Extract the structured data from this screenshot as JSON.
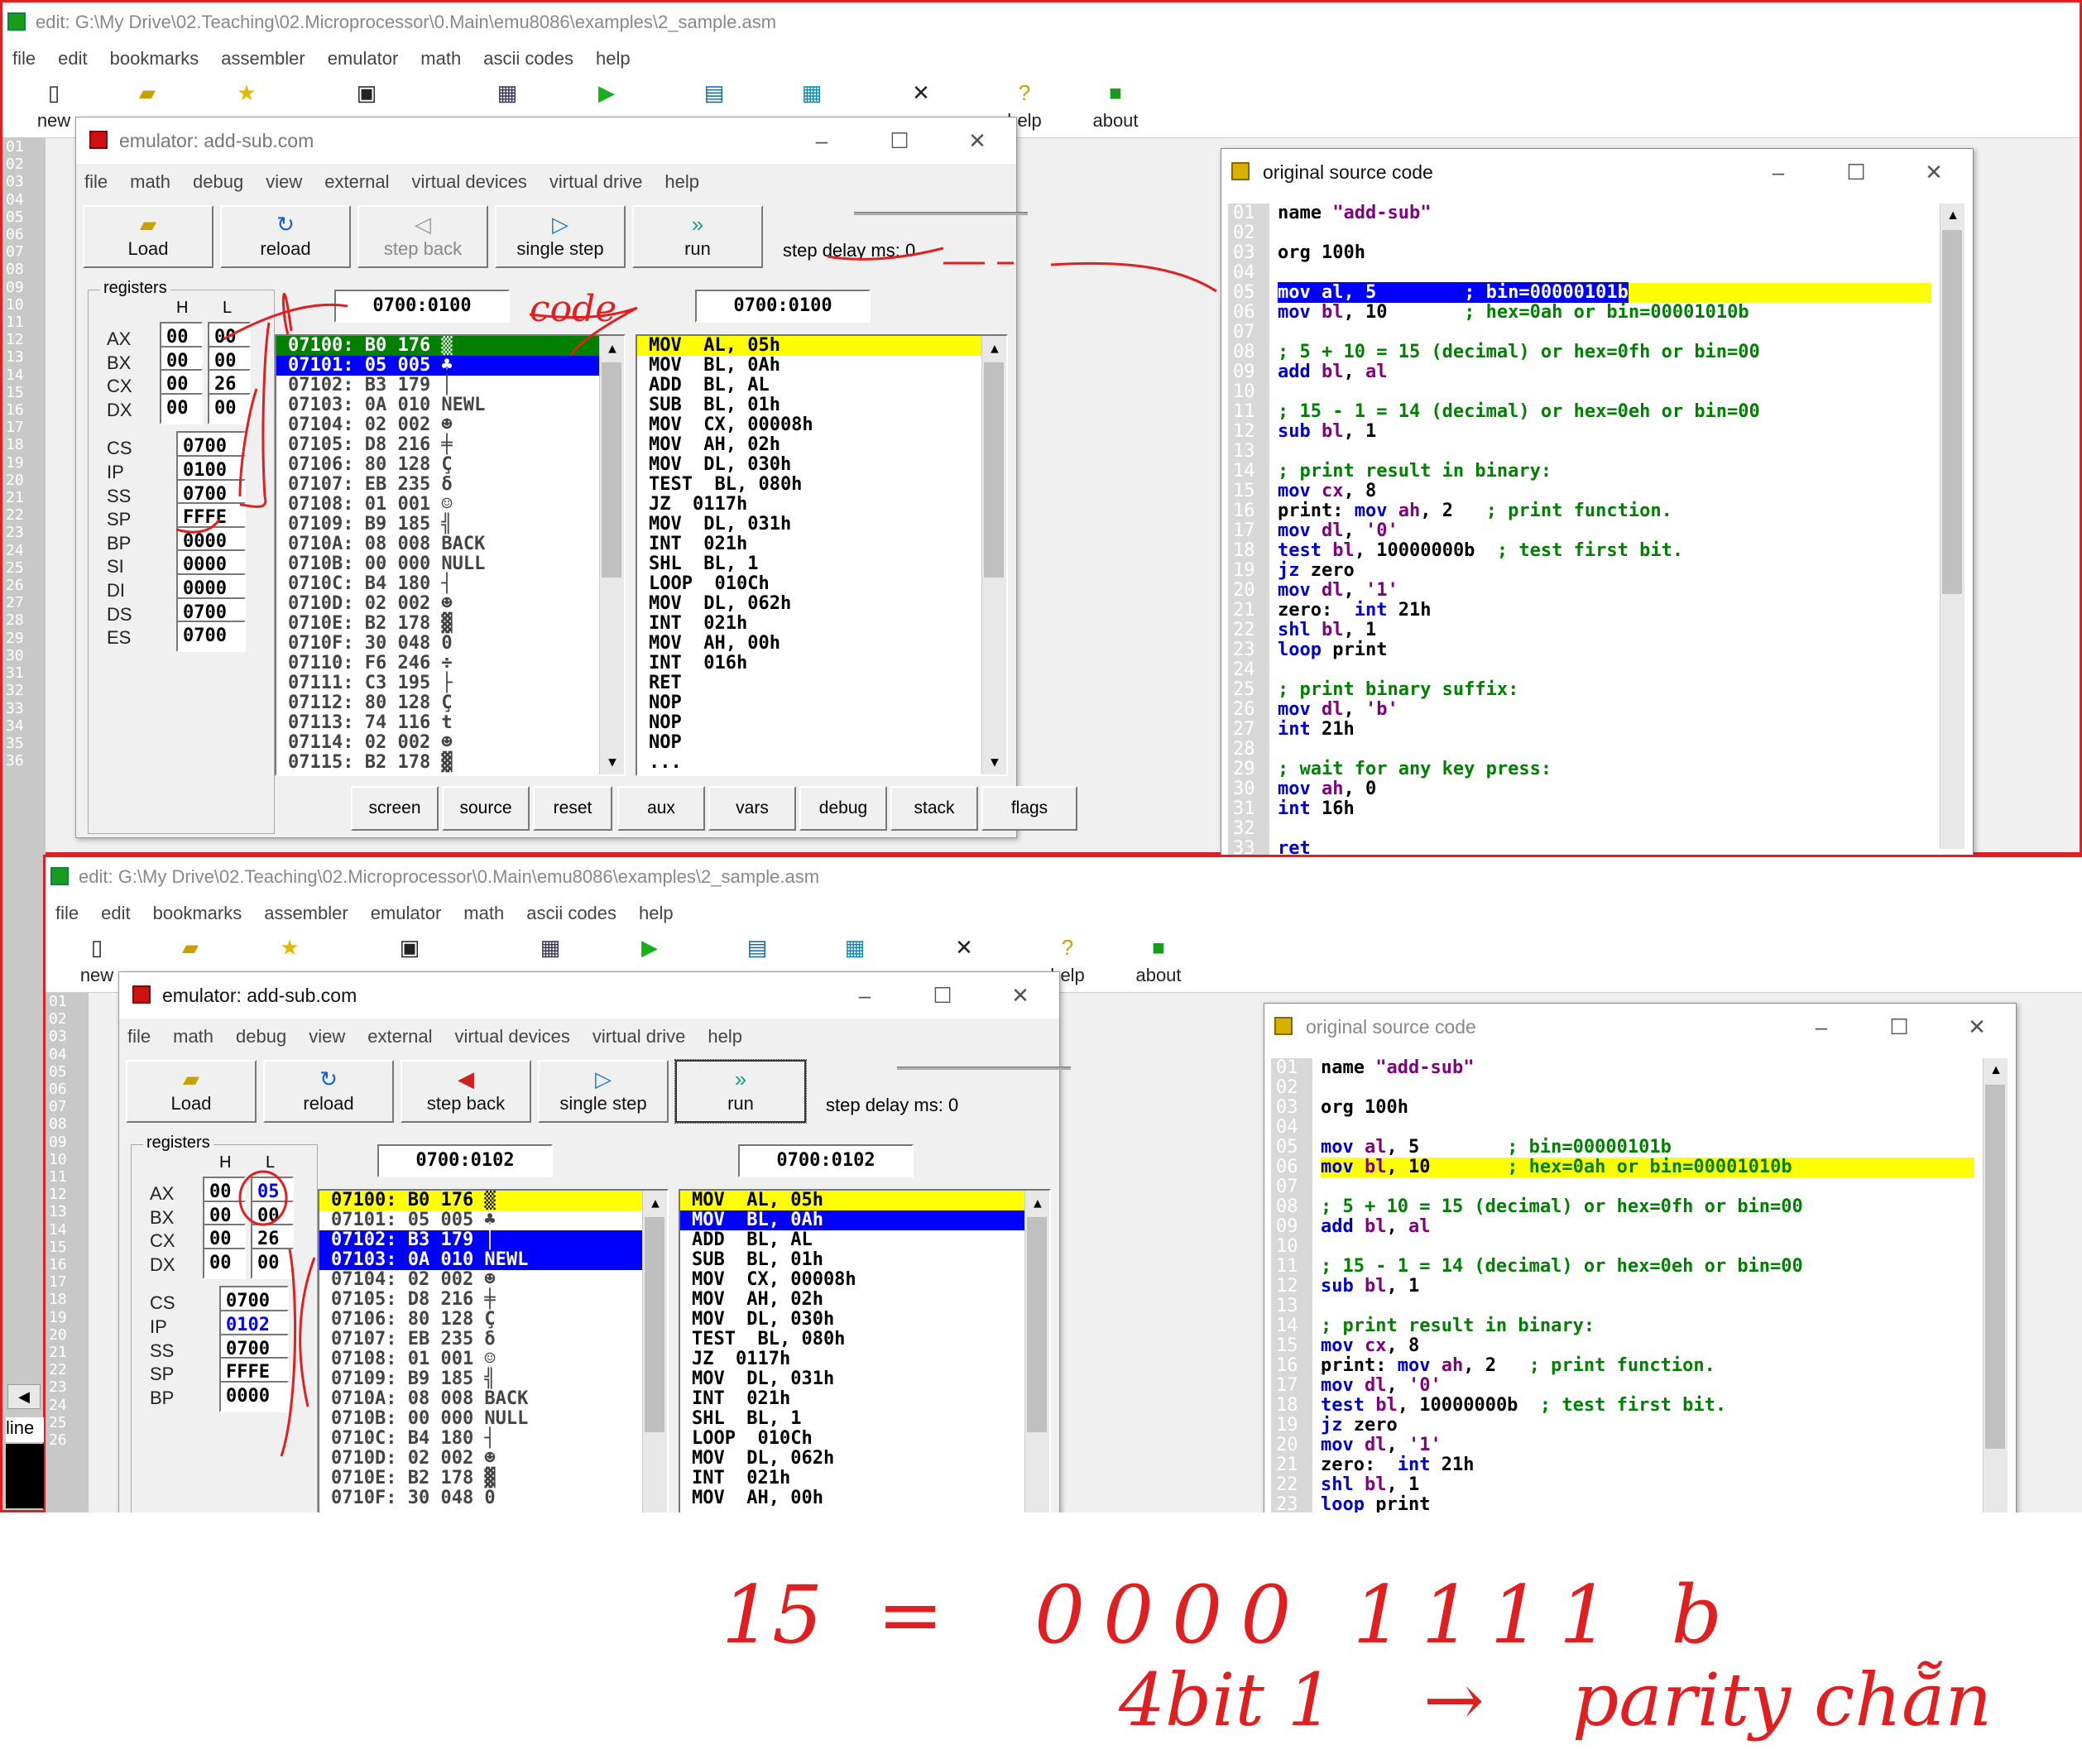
{
  "editor": {
    "title": "edit: G:\\My Drive\\02.Teaching\\02.Microprocessor\\0.Main\\emu8086\\examples\\2_sample.asm",
    "menu": [
      "file",
      "edit",
      "bookmarks",
      "assembler",
      "emulator",
      "math",
      "ascii codes",
      "help"
    ],
    "toolbar": {
      "new": "new",
      "help": "help",
      "about": "about"
    },
    "gutter_top": [
      "01",
      "02",
      "03",
      "04",
      "05",
      "06",
      "07",
      "08",
      "09",
      "10",
      "11",
      "12",
      "13",
      "14",
      "15",
      "16",
      "17",
      "18",
      "19",
      "20",
      "21",
      "22",
      "23",
      "24",
      "25",
      "26",
      "27",
      "28",
      "29",
      "30",
      "31",
      "32",
      "33",
      "34",
      "35",
      "36"
    ],
    "gutter_bottom": [
      "01",
      "02",
      "03",
      "04",
      "05",
      "06",
      "07",
      "08",
      "09",
      "10",
      "11",
      "12",
      "13",
      "14",
      "15",
      "16",
      "17",
      "18",
      "19",
      "20",
      "21",
      "22",
      "23",
      "24",
      "25",
      "26"
    ],
    "side_label": "line"
  },
  "emulator_top": {
    "title": "emulator: add-sub.com",
    "menu": [
      "file",
      "math",
      "debug",
      "view",
      "external",
      "virtual devices",
      "virtual drive",
      "help"
    ],
    "buttons": {
      "load": "Load",
      "reload": "reload",
      "step_back": "step back",
      "single_step": "single step",
      "run": "run"
    },
    "step_delay": "step delay ms: 0",
    "registers_label": "registers",
    "h": "H",
    "l": "L",
    "regs": {
      "AX_H": "00",
      "AX_L": "00",
      "BX_H": "00",
      "BX_L": "00",
      "CX_H": "00",
      "CX_L": "26",
      "DX_H": "00",
      "DX_L": "00",
      "CS": "0700",
      "IP": "0100",
      "SS": "0700",
      "SP": "FFFE",
      "BP": "0000",
      "SI": "0000",
      "DI": "0000",
      "DS": "0700",
      "ES": "0700"
    },
    "addr_left": "0700:0100",
    "addr_right": "0700:0100",
    "memory": [
      "07100: B0 176 ▒",
      "07101: 05 005 ♣",
      "07102: B3 179 │",
      "07103: 0A 010 NEWL",
      "07104: 02 002 ☻",
      "07105: D8 216 ╪",
      "07106: 80 128 Ç",
      "07107: EB 235 δ",
      "07108: 01 001 ☺",
      "07109: B9 185 ╣",
      "0710A: 08 008 BACK",
      "0710B: 00 000 NULL",
      "0710C: B4 180 ┤",
      "0710D: 02 002 ☻",
      "0710E: B2 178 ▓",
      "0710F: 30 048 0",
      "07110: F6 246 ÷",
      "07111: C3 195 ├",
      "07112: 80 128 Ç",
      "07113: 74 116 t",
      "07114: 02 002 ☻",
      "07115: B2 178 ▓"
    ],
    "disasm": [
      "MOV  AL, 05h",
      "MOV  BL, 0Ah",
      "ADD  BL, AL",
      "SUB  BL, 01h",
      "MOV  CX, 00008h",
      "MOV  AH, 02h",
      "MOV  DL, 030h",
      "TEST  BL, 080h",
      "JZ  0117h",
      "MOV  DL, 031h",
      "INT  021h",
      "SHL  BL, 1",
      "LOOP  010Ch",
      "MOV  DL, 062h",
      "INT  021h",
      "MOV  AH, 00h",
      "INT  016h",
      "RET",
      "NOP",
      "NOP",
      "NOP",
      "..."
    ],
    "bottom_buttons": [
      "screen",
      "source",
      "reset",
      "aux",
      "vars",
      "debug",
      "stack",
      "flags"
    ]
  },
  "emulator_bottom": {
    "regs": {
      "AX_H": "00",
      "AX_L": "05",
      "BX_H": "00",
      "BX_L": "00",
      "CX_H": "00",
      "CX_L": "26",
      "DX_H": "00",
      "DX_L": "00",
      "CS": "0700",
      "IP": "0102",
      "SS": "0700",
      "SP": "FFFE",
      "BP": "0000"
    },
    "addr_left": "0700:0102",
    "addr_right": "0700:0102",
    "memory": [
      "07100: B0 176 ▒",
      "07101: 05 005 ♣",
      "07102: B3 179 │",
      "07103: 0A 010 NEWL",
      "07104: 02 002 ☻",
      "07105: D8 216 ╪",
      "07106: 80 128 Ç",
      "07107: EB 235 δ",
      "07108: 01 001 ☺",
      "07109: B9 185 ╣",
      "0710A: 08 008 BACK",
      "0710B: 00 000 NULL",
      "0710C: B4 180 ┤",
      "0710D: 02 002 ☻",
      "0710E: B2 178 ▓",
      "0710F: 30 048 0"
    ],
    "disasm": [
      "MOV  AL, 05h",
      "MOV  BL, 0Ah",
      "ADD  BL, AL",
      "SUB  BL, 01h",
      "MOV  CX, 00008h",
      "MOV  AH, 02h",
      "MOV  DL, 030h",
      "TEST  BL, 080h",
      "JZ  0117h",
      "MOV  DL, 031h",
      "INT  021h",
      "SHL  BL, 1",
      "LOOP  010Ch",
      "MOV  DL, 062h",
      "INT  021h",
      "MOV  AH, 00h"
    ]
  },
  "source": {
    "title": "original source code",
    "lines": [
      {
        "n": "01",
        "segs": [
          [
            "black",
            "name "
          ],
          [
            "str",
            "\"add-sub\""
          ]
        ]
      },
      {
        "n": "02",
        "segs": []
      },
      {
        "n": "03",
        "segs": [
          [
            "black",
            "org 100h"
          ]
        ]
      },
      {
        "n": "04",
        "segs": []
      },
      {
        "n": "05",
        "segs": [
          [
            "kw",
            "mov "
          ],
          [
            "str",
            "al"
          ],
          [
            "black",
            ", 5        "
          ],
          [
            "cmt",
            "; bin=00000101b"
          ]
        ]
      },
      {
        "n": "06",
        "segs": [
          [
            "kw",
            "mov "
          ],
          [
            "str",
            "bl"
          ],
          [
            "black",
            ", 10       "
          ],
          [
            "cmt",
            "; hex=0ah or bin=00001010b"
          ]
        ]
      },
      {
        "n": "07",
        "segs": []
      },
      {
        "n": "08",
        "segs": [
          [
            "cmt",
            "; 5 + 10 = 15 (decimal) or hex=0fh or bin=00"
          ]
        ]
      },
      {
        "n": "09",
        "segs": [
          [
            "kw",
            "add "
          ],
          [
            "str",
            "bl"
          ],
          [
            "black",
            ", "
          ],
          [
            "str",
            "al"
          ]
        ]
      },
      {
        "n": "10",
        "segs": []
      },
      {
        "n": "11",
        "segs": [
          [
            "cmt",
            "; 15 - 1 = 14 (decimal) or hex=0eh or bin=00"
          ]
        ]
      },
      {
        "n": "12",
        "segs": [
          [
            "kw",
            "sub "
          ],
          [
            "str",
            "bl"
          ],
          [
            "black",
            ", 1"
          ]
        ]
      },
      {
        "n": "13",
        "segs": []
      },
      {
        "n": "14",
        "segs": [
          [
            "cmt",
            "; print result in binary:"
          ]
        ]
      },
      {
        "n": "15",
        "segs": [
          [
            "kw",
            "mov "
          ],
          [
            "str",
            "cx"
          ],
          [
            "black",
            ", 8"
          ]
        ]
      },
      {
        "n": "16",
        "segs": [
          [
            "black",
            "print: "
          ],
          [
            "kw",
            "mov "
          ],
          [
            "str",
            "ah"
          ],
          [
            "black",
            ", 2   "
          ],
          [
            "cmt",
            "; print function."
          ]
        ]
      },
      {
        "n": "17",
        "segs": [
          [
            "kw",
            "mov "
          ],
          [
            "str",
            "dl"
          ],
          [
            "black",
            ", "
          ],
          [
            "str",
            "'0'"
          ]
        ]
      },
      {
        "n": "18",
        "segs": [
          [
            "kw",
            "test "
          ],
          [
            "str",
            "bl"
          ],
          [
            "black",
            ", 10000000b  "
          ],
          [
            "cmt",
            "; test first bit."
          ]
        ]
      },
      {
        "n": "19",
        "segs": [
          [
            "kw",
            "jz "
          ],
          [
            "black",
            "zero"
          ]
        ]
      },
      {
        "n": "20",
        "segs": [
          [
            "kw",
            "mov "
          ],
          [
            "str",
            "dl"
          ],
          [
            "black",
            ", "
          ],
          [
            "str",
            "'1'"
          ]
        ]
      },
      {
        "n": "21",
        "segs": [
          [
            "black",
            "zero:  "
          ],
          [
            "kw",
            "int "
          ],
          [
            "black",
            "21h"
          ]
        ]
      },
      {
        "n": "22",
        "segs": [
          [
            "kw",
            "shl "
          ],
          [
            "str",
            "bl"
          ],
          [
            "black",
            ", 1"
          ]
        ]
      },
      {
        "n": "23",
        "segs": [
          [
            "kw",
            "loop "
          ],
          [
            "black",
            "print"
          ]
        ]
      },
      {
        "n": "24",
        "segs": []
      },
      {
        "n": "25",
        "segs": [
          [
            "cmt",
            "; print binary suffix:"
          ]
        ]
      },
      {
        "n": "26",
        "segs": [
          [
            "kw",
            "mov "
          ],
          [
            "str",
            "dl"
          ],
          [
            "black",
            ", "
          ],
          [
            "str",
            "'b'"
          ]
        ]
      },
      {
        "n": "27",
        "segs": [
          [
            "kw",
            "int "
          ],
          [
            "black",
            "21h"
          ]
        ]
      },
      {
        "n": "28",
        "segs": []
      },
      {
        "n": "29",
        "segs": [
          [
            "cmt",
            "; wait for any key press:"
          ]
        ]
      },
      {
        "n": "30",
        "segs": [
          [
            "kw",
            "mov "
          ],
          [
            "str",
            "ah"
          ],
          [
            "black",
            ", 0"
          ]
        ]
      },
      {
        "n": "31",
        "segs": [
          [
            "kw",
            "int "
          ],
          [
            "black",
            "16h"
          ]
        ]
      },
      {
        "n": "32",
        "segs": []
      },
      {
        "n": "33",
        "segs": [
          [
            "kw",
            "ret"
          ]
        ]
      }
    ]
  },
  "annotations": {
    "code_label": "code",
    "equation_lhs": "15",
    "equals": "=",
    "binary": "0000 1111 b",
    "count": "4bit 1",
    "arrow": "→",
    "parity": "parity chẵn"
  },
  "colors": {
    "memory_current": "#008000",
    "memory_selected": "#0000ff",
    "source_highlight": "#ffff00",
    "handwriting": "#e02020"
  }
}
